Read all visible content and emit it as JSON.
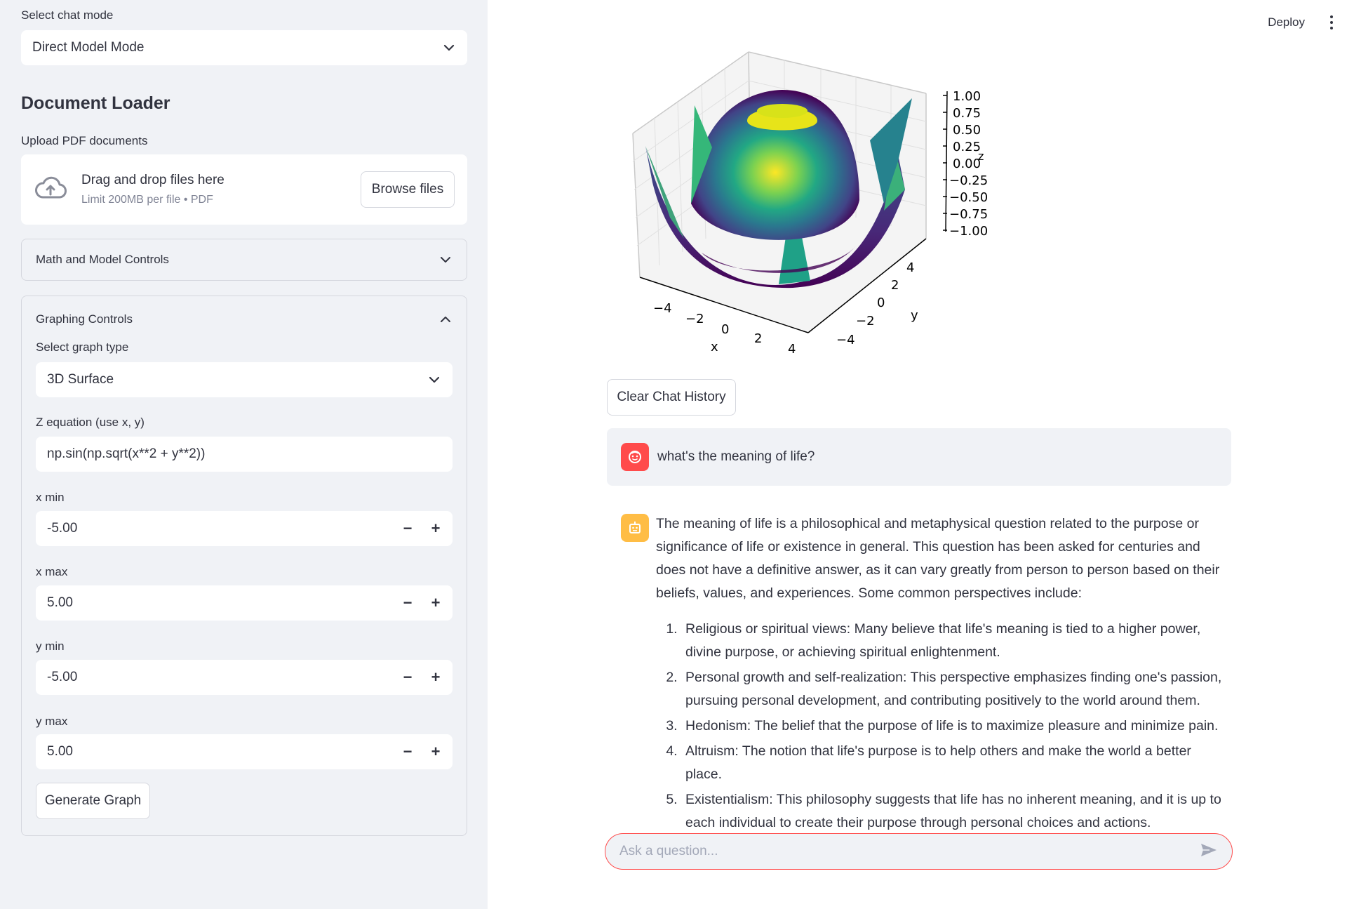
{
  "sidebar": {
    "chat_mode_label": "Select chat mode",
    "chat_mode_value": "Direct Model Mode",
    "doc_loader_title": "Document Loader",
    "upload_label": "Upload PDF documents",
    "upload_main": "Drag and drop files here",
    "upload_sub": "Limit 200MB per file • PDF",
    "browse_label": "Browse files",
    "math_controls_label": "Math and Model Controls",
    "graph_controls": {
      "title": "Graphing Controls",
      "graph_type_label": "Select graph type",
      "graph_type_value": "3D Surface",
      "z_label": "Z equation (use x, y)",
      "z_value": "np.sin(np.sqrt(x**2 + y**2))",
      "xmin_label": "x min",
      "xmin_value": "-5.00",
      "xmax_label": "x max",
      "xmax_value": "5.00",
      "ymin_label": "y min",
      "ymin_value": "-5.00",
      "ymax_label": "y max",
      "ymax_value": "5.00",
      "minus": "−",
      "plus": "+",
      "generate_label": "Generate Graph"
    }
  },
  "header": {
    "deploy_label": "Deploy"
  },
  "plot": {
    "z_ticks": [
      "1.00",
      "0.75",
      "0.50",
      "0.25",
      "0.00",
      "−0.25",
      "−0.50",
      "−0.75",
      "−1.00"
    ],
    "x_ticks": [
      "−4",
      "−2",
      "0",
      "2",
      "4"
    ],
    "y_ticks": [
      "4",
      "2",
      "0",
      "−2",
      "−4"
    ],
    "x_label": "x",
    "y_label": "y",
    "z_label": "z"
  },
  "chat": {
    "clear_label": "Clear Chat History",
    "user_message": "what's the meaning of life?",
    "ai_intro": "The meaning of life is a philosophical and metaphysical question related to the purpose or significance of life or existence in general. This question has been asked for centuries and does not have a definitive answer, as it can vary greatly from person to person based on their beliefs, values, and experiences. Some common perspectives include:",
    "ai_items": [
      "Religious or spiritual views: Many believe that life's meaning is tied to a higher power, divine purpose, or achieving spiritual enlightenment.",
      "Personal growth and self-realization: This perspective emphasizes finding one's passion, pursuing personal development, and contributing positively to the world around them.",
      "Hedonism: The belief that the purpose of life is to maximize pleasure and minimize pain.",
      "Altruism: The notion that life's purpose is to help others and make the world a better place.",
      "Existentialism: This philosophy suggests that life has no inherent meaning, and it is up to each individual to create their purpose through personal choices and actions."
    ],
    "input_placeholder": "Ask a question..."
  },
  "colors": {
    "accent": "#ff4b4b",
    "user_avatar": "#ff4b4b",
    "ai_avatar": "#ffbd45"
  }
}
